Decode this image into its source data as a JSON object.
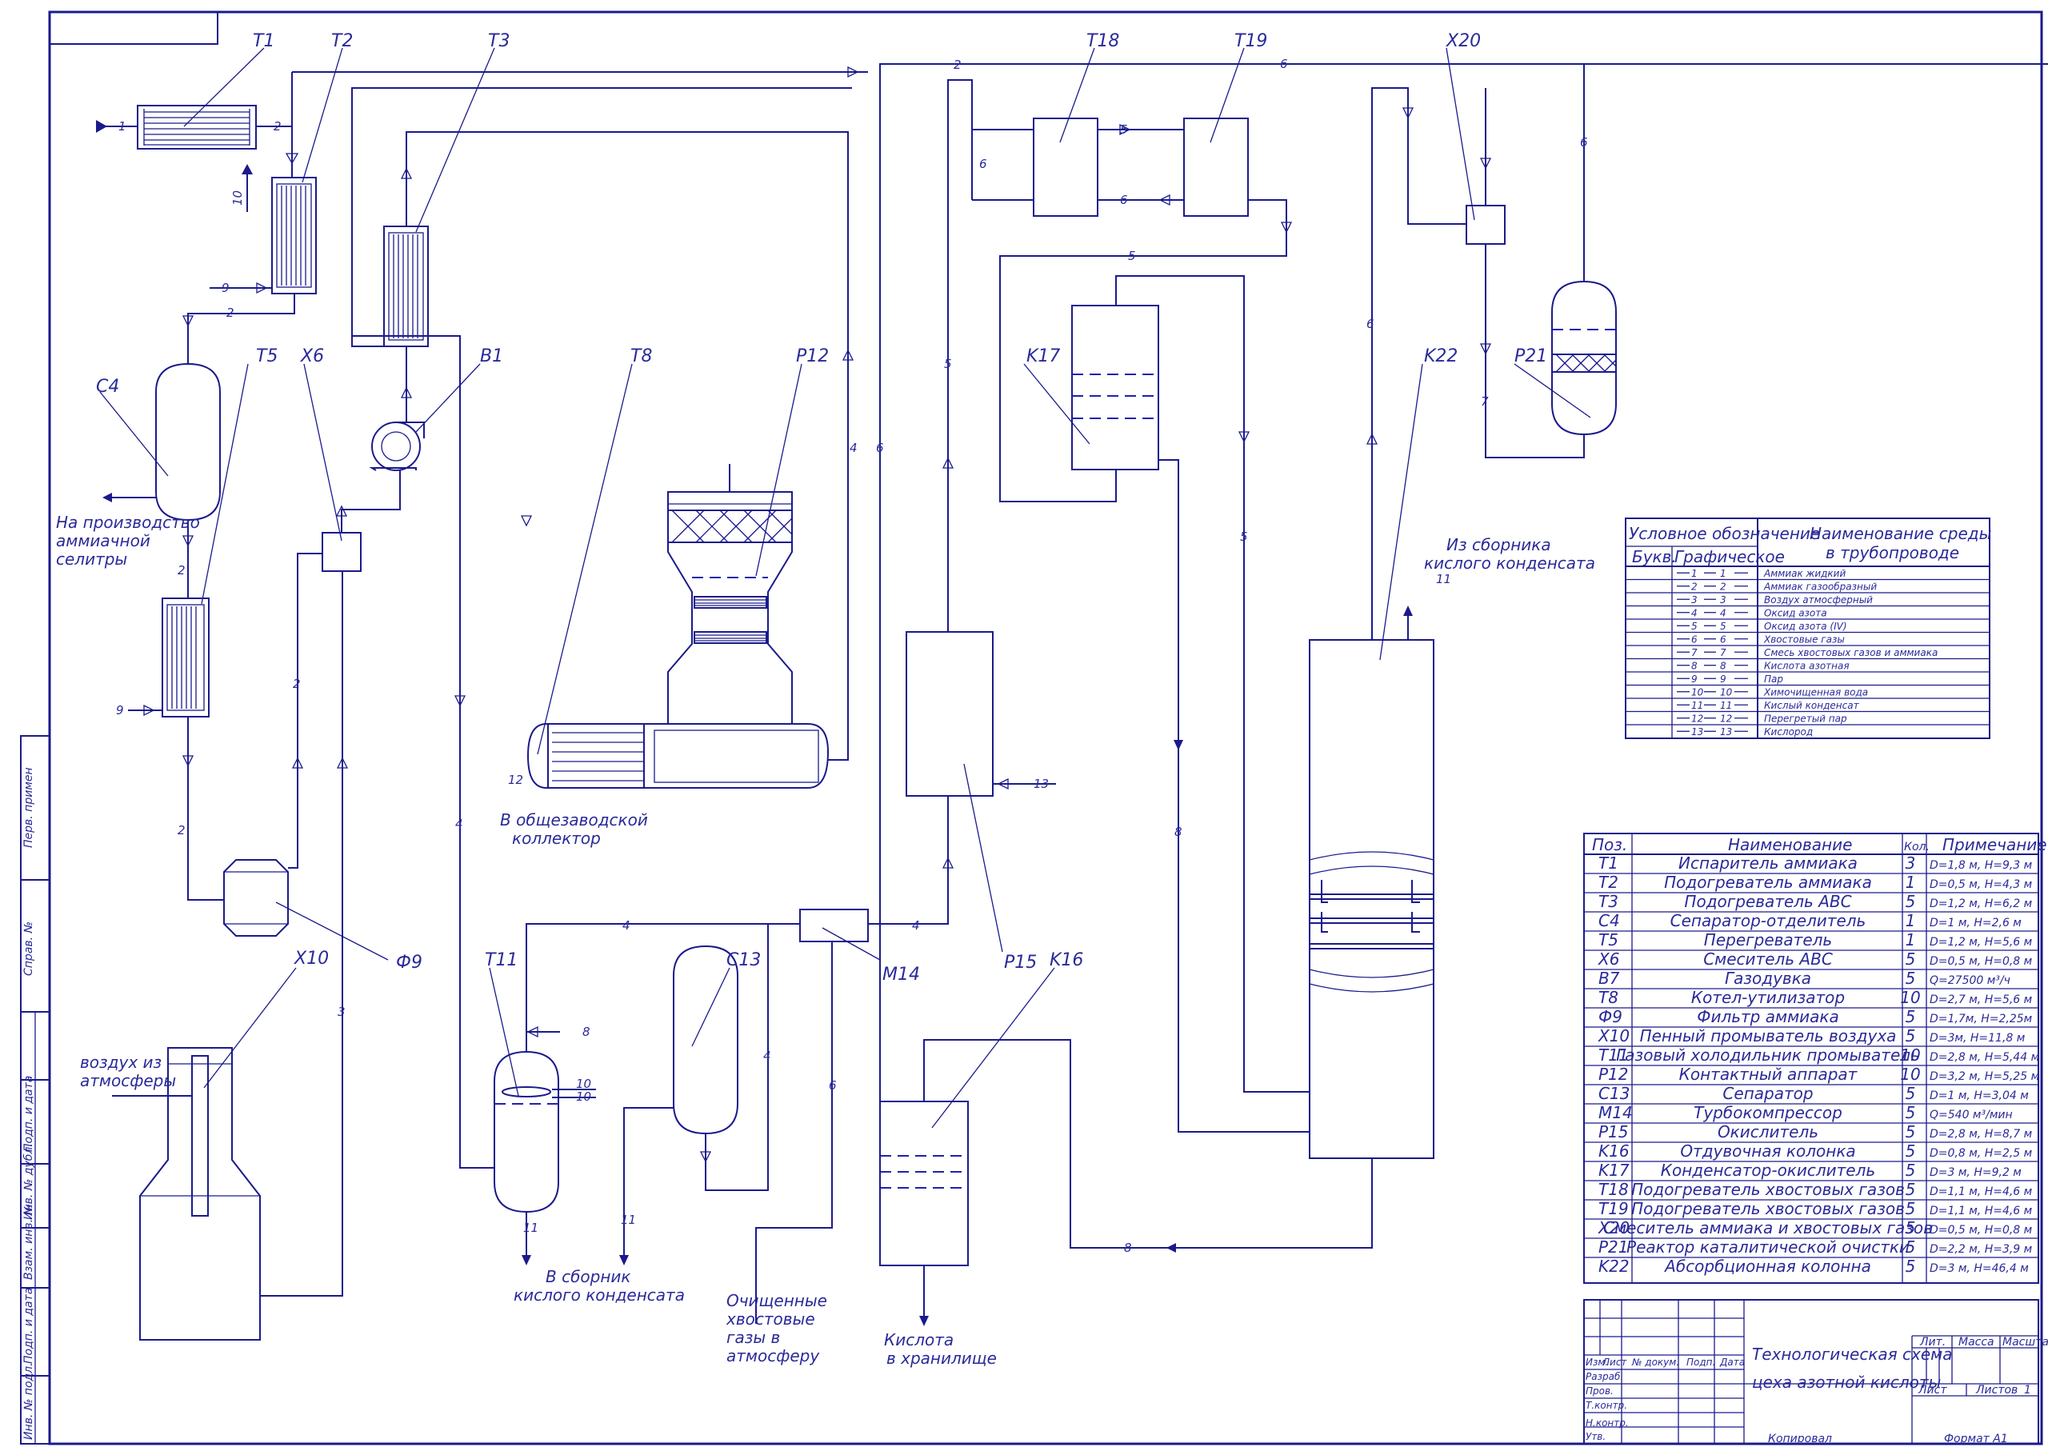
{
  "frame_sidebar": [
    "Перв. примен",
    "Справ. №",
    "Подп. и дата",
    "Инв. № дубл.",
    "Взам. инв. №",
    "Подп. и дата",
    "Инв. № подл."
  ],
  "equipment_labels": {
    "T1": "T1",
    "T2": "T2",
    "T3": "T3",
    "C4": "C4",
    "T5": "T5",
    "X6": "X6",
    "B1": "B1",
    "T8": "T8",
    "P12": "P12",
    "F9": "Ф9",
    "X10": "X10",
    "T11": "T11",
    "C13": "C13",
    "M14": "M14",
    "P15": "P15",
    "K16": "K16",
    "K17": "K17",
    "T18": "T18",
    "T19": "T19",
    "X20": "X20",
    "P21": "P21",
    "K22": "K22"
  },
  "annotations": {
    "production_1": "На производство",
    "production_2": "аммиачной",
    "production_3": "селитры",
    "air_1": "воздух из",
    "air_2": "атмосферы",
    "collector_1": "В общезаводской",
    "collector_2": "коллектор",
    "condensate_1": "В сборник",
    "condensate_2": "кислого конденсата",
    "purified_1": "Очищенные",
    "purified_2": "хвостовые",
    "purified_3": "газы в",
    "purified_4": "атмосферу",
    "acid_1": "Кислота",
    "acid_2": "в хранилище",
    "from_coll_1": "Из сборника",
    "from_coll_2": "кислого конденсата"
  },
  "legend": {
    "header_symbol": "Условное обозначение",
    "header_letter": "Букв.",
    "header_graphic": "Графическое",
    "header_medium_1": "Наименование среды",
    "header_medium_2": "в трубопроводе",
    "rows": [
      {
        "num": "1",
        "name": "Аммиак жидкий"
      },
      {
        "num": "2",
        "name": "Аммиак газообразный"
      },
      {
        "num": "3",
        "name": "Воздух атмосферный"
      },
      {
        "num": "4",
        "name": "Оксид азота"
      },
      {
        "num": "5",
        "name": "Оксид азота (IV)"
      },
      {
        "num": "6",
        "name": "Хвостовые газы"
      },
      {
        "num": "7",
        "name": "Смесь хвостовых газов и аммиака"
      },
      {
        "num": "8",
        "name": "Кислота азотная"
      },
      {
        "num": "9",
        "name": "Пар"
      },
      {
        "num": "10",
        "name": "Химочищенная вода"
      },
      {
        "num": "11",
        "name": "Кислый конденсат"
      },
      {
        "num": "12",
        "name": "Перегретый пар"
      },
      {
        "num": "13",
        "name": "Кислород"
      }
    ]
  },
  "spec": {
    "headers": [
      "Поз.",
      "Наименование",
      "Кол.",
      "Примечание"
    ],
    "rows": [
      [
        "T1",
        "Испаритель аммиака",
        "3",
        "D=1,8 м, H=9,3 м"
      ],
      [
        "T2",
        "Подогреватель аммиака",
        "1",
        "D=0,5 м, H=4,3 м"
      ],
      [
        "T3",
        "Подогреватель АВС",
        "5",
        "D=1,2 м, H=6,2 м"
      ],
      [
        "C4",
        "Сепаратор-отделитель",
        "1",
        "D=1 м, H=2,6 м"
      ],
      [
        "T5",
        "Перегреватель",
        "1",
        "D=1,2 м, H=5,6 м"
      ],
      [
        "X6",
        "Смеситель АВС",
        "5",
        "D=0,5 м, H=0,8 м"
      ],
      [
        "B7",
        "Газодувка",
        "5",
        "Q=27500 м³/ч"
      ],
      [
        "T8",
        "Котел-утилизатор",
        "10",
        "D=2,7 м, H=5,6 м"
      ],
      [
        "Ф9",
        "Фильтр аммиака",
        "5",
        "D=1,7м, H=2,25м"
      ],
      [
        "X10",
        "Пенный промыватель воздуха",
        "5",
        "D=3м, H=11,8 м"
      ],
      [
        "T11",
        "Газовый холодильник промыватель",
        "10",
        "D=2,8 м, H=5,44 м"
      ],
      [
        "P12",
        "Контактный аппарат",
        "10",
        "D=3,2 м, H=5,25 м"
      ],
      [
        "C13",
        "Сепаратор",
        "5",
        "D=1 м, H=3,04 м"
      ],
      [
        "M14",
        "Турбокомпрессор",
        "5",
        "Q=540 м³/мин"
      ],
      [
        "P15",
        "Окислитель",
        "5",
        "D=2,8 м, H=8,7 м"
      ],
      [
        "K16",
        "Отдувочная колонка",
        "5",
        "D=0,8 м, H=2,5 м"
      ],
      [
        "K17",
        "Конденсатор-окислитель",
        "5",
        "D=3 м, H=9,2 м"
      ],
      [
        "T18",
        "Подогреватель хвостовых газов",
        "5",
        "D=1,1 м, H=4,6 м"
      ],
      [
        "T19",
        "Подогреватель хвостовых газов",
        "5",
        "D=1,1 м, H=4,6 м"
      ],
      [
        "X20",
        "Смеситель аммиака и хвостовых газов",
        "5",
        "D=0,5 м, H=0,8 м"
      ],
      [
        "P21",
        "Реактор каталитической очистки",
        "5",
        "D=2,2 м, H=3,9 м"
      ],
      [
        "K22",
        "Абсорбционная колонна",
        "5",
        "D=3 м, H=46,4 м"
      ]
    ]
  },
  "title_block": {
    "title_1": "Технологическая схема",
    "title_2": "цеха азотной кислоты",
    "cols": [
      "Изм.",
      "Лист",
      "№ докум.",
      "Подп.",
      "Дата"
    ],
    "roles": [
      "Разраб.",
      "Пров.",
      "Т.контр.",
      "",
      "Н.контр.",
      "Утв."
    ],
    "lit": "Лит.",
    "mass": "Масса",
    "scale": "Масштаб",
    "sheet": "Лист",
    "sheets": "Листов",
    "sheets_count": "1",
    "copied": "Копировал",
    "format": "Формат A1"
  }
}
